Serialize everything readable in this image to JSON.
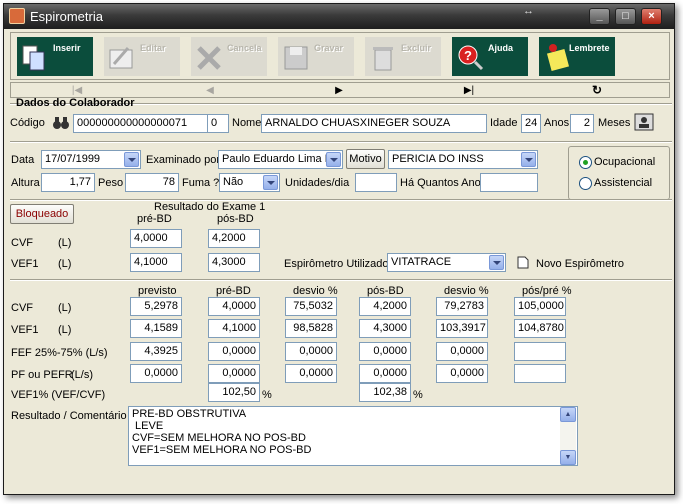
{
  "window": {
    "title": "Espirometria"
  },
  "toolbar": {
    "inserir": "Inserir",
    "editar": "Editar",
    "cancela": "Cancela",
    "gravar": "Gravar",
    "excluir": "Excluir",
    "ajuda": "Ajuda",
    "lembrete": "Lembrete"
  },
  "nav": {
    "first": "|◀",
    "prev": "◀",
    "next": "▶",
    "last": "▶|",
    "refresh": "↻"
  },
  "colaborador": {
    "section_title": "Dados do Colaborador",
    "codigo_label": "Código",
    "codigo": "000000000000000071",
    "codigo_digit": "0",
    "nome_label": "Nome",
    "nome": "ARNALDO CHUASXINEGER SOUZA",
    "idade_label": "Idade",
    "anos_value": "24",
    "anos_label": "Anos",
    "meses_value": "2",
    "meses_label": "Meses"
  },
  "exame": {
    "data_label": "Data",
    "data": "17/07/1999",
    "examinado_label": "Examinado por",
    "examinado": "Paulo Eduardo Lima L",
    "motivo_button": "Motivo",
    "motivo": "PERICIA DO INSS",
    "altura_label": "Altura",
    "altura": "1,77",
    "peso_label": "Peso",
    "peso": "78",
    "fuma_label": "Fuma ?",
    "fuma": "Não",
    "unidades_label": "Unidades/dia",
    "unidades": "",
    "quantos_label": "Há Quantos Ano",
    "quantos": "",
    "tipo_ocupacional": "Ocupacional",
    "tipo_assistencial": "Assistencial"
  },
  "exame1": {
    "bloqueado_button": "Bloqueado",
    "header": "Resultado do Exame 1",
    "col_pre": "pré-BD",
    "col_pos": "pós-BD",
    "rows": [
      {
        "label": "CVF",
        "unit": "(L)",
        "pre": "4,0000",
        "pos": "4,2000"
      },
      {
        "label": "VEF1",
        "unit": "(L)",
        "pre": "4,1000",
        "pos": "4,3000"
      }
    ],
    "espirometro_label": "Espirômetro Utilizado",
    "espirometro": "VITATRACE",
    "novo_espirometro": "Novo Espirômetro"
  },
  "resultados": {
    "headers": [
      "previsto",
      "pré-BD",
      "desvio %",
      "pós-BD",
      "desvio %",
      "pós/pré %"
    ],
    "rows": [
      {
        "label": "CVF",
        "unit": "(L)",
        "values": [
          "5,2978",
          "4,0000",
          "75,5032",
          "4,2000",
          "79,2783",
          "105,0000"
        ]
      },
      {
        "label": "VEF1",
        "unit": "(L)",
        "values": [
          "4,1589",
          "4,1000",
          "98,5828",
          "4,3000",
          "103,3917",
          "104,8780"
        ]
      },
      {
        "label": "FEF 25%-75% (L/s)",
        "unit": "",
        "values": [
          "4,3925",
          "0,0000",
          "0,0000",
          "0,0000",
          "0,0000",
          ""
        ]
      },
      {
        "label": "PF ou PEFR",
        "unit": "(L/s)",
        "values": [
          "0,0000",
          "0,0000",
          "0,0000",
          "0,0000",
          "0,0000",
          ""
        ]
      }
    ],
    "vef_label": "VEF1%  (VEF/CVF)",
    "vef_pre": "102,50",
    "vef_pos": "102,38",
    "pct": "%",
    "comentario_label": "Resultado / Comentário",
    "comentario": [
      "PRE-BD OBSTRUTIVA",
      " LEVE",
      "CVF=SEM MELHORA NO POS-BD",
      "VEF1=SEM MELHORA NO POS-BD"
    ]
  }
}
